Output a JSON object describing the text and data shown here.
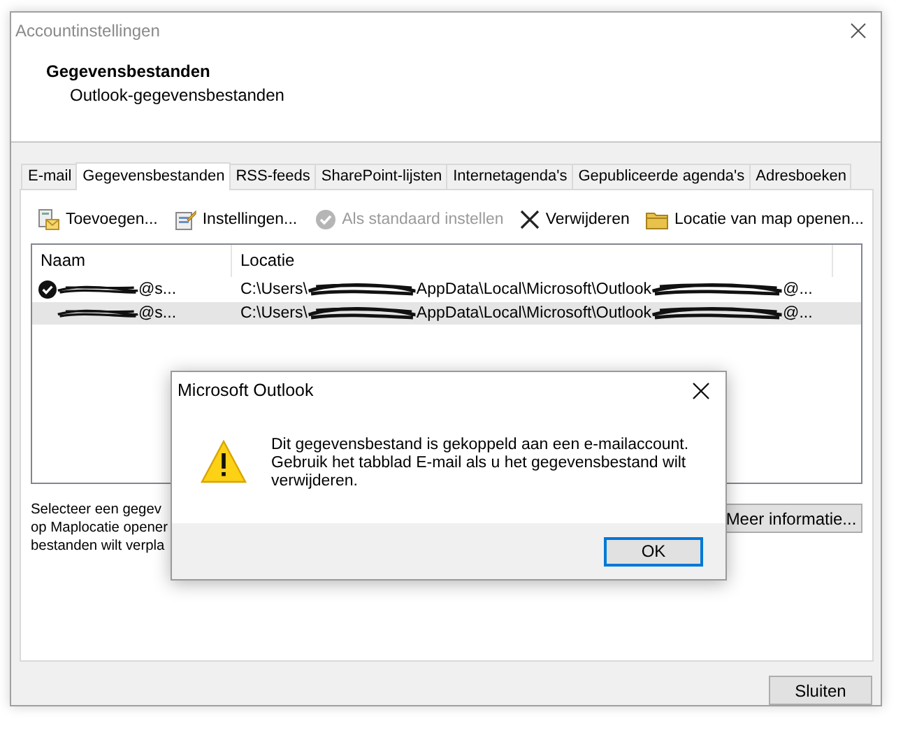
{
  "window": {
    "title": "Accountinstellingen",
    "header_title": "Gegevensbestanden",
    "header_subtitle": "Outlook-gegevensbestanden"
  },
  "tabs": [
    {
      "label": "E-mail",
      "selected": false
    },
    {
      "label": "Gegevensbestanden",
      "selected": true
    },
    {
      "label": "RSS-feeds",
      "selected": false
    },
    {
      "label": "SharePoint-lijsten",
      "selected": false
    },
    {
      "label": "Internetagenda's",
      "selected": false
    },
    {
      "label": "Gepubliceerde agenda's",
      "selected": false
    },
    {
      "label": "Adresboeken",
      "selected": false
    }
  ],
  "toolbar": [
    {
      "label": "Toevoegen...",
      "disabled": false
    },
    {
      "label": "Instellingen...",
      "disabled": false
    },
    {
      "label": "Als standaard instellen",
      "disabled": true
    },
    {
      "label": "Verwijderen",
      "disabled": false
    },
    {
      "label": "Locatie van map openen...",
      "disabled": false
    }
  ],
  "table": {
    "columns": [
      "Naam",
      "Locatie"
    ],
    "rows": [
      {
        "default": true,
        "selected": false,
        "name": "@s...",
        "location_start": "C:\\Users\\",
        "location_middle": "AppData\\Local\\Microsoft\\Outlook",
        "location_end": "@..."
      },
      {
        "default": false,
        "selected": true,
        "name": "@s...",
        "location_start": "C:\\Users\\",
        "location_middle": "AppData\\Local\\Microsoft\\Outlook",
        "location_end": "@..."
      }
    ]
  },
  "description_lines": [
    "Selecteer een gegev",
    "op Maplocatie opener",
    "bestanden wilt verpla"
  ],
  "more_info_button": "Meer informatie...",
  "close_button": "Sluiten",
  "dialog": {
    "title": "Microsoft Outlook",
    "message_lines": [
      "Dit gegevensbestand is gekoppeld aan een e-mailaccount.",
      "Gebruik het tabblad E-mail als u het gegevensbestand wilt",
      "verwijderen."
    ],
    "ok_button": "OK"
  }
}
